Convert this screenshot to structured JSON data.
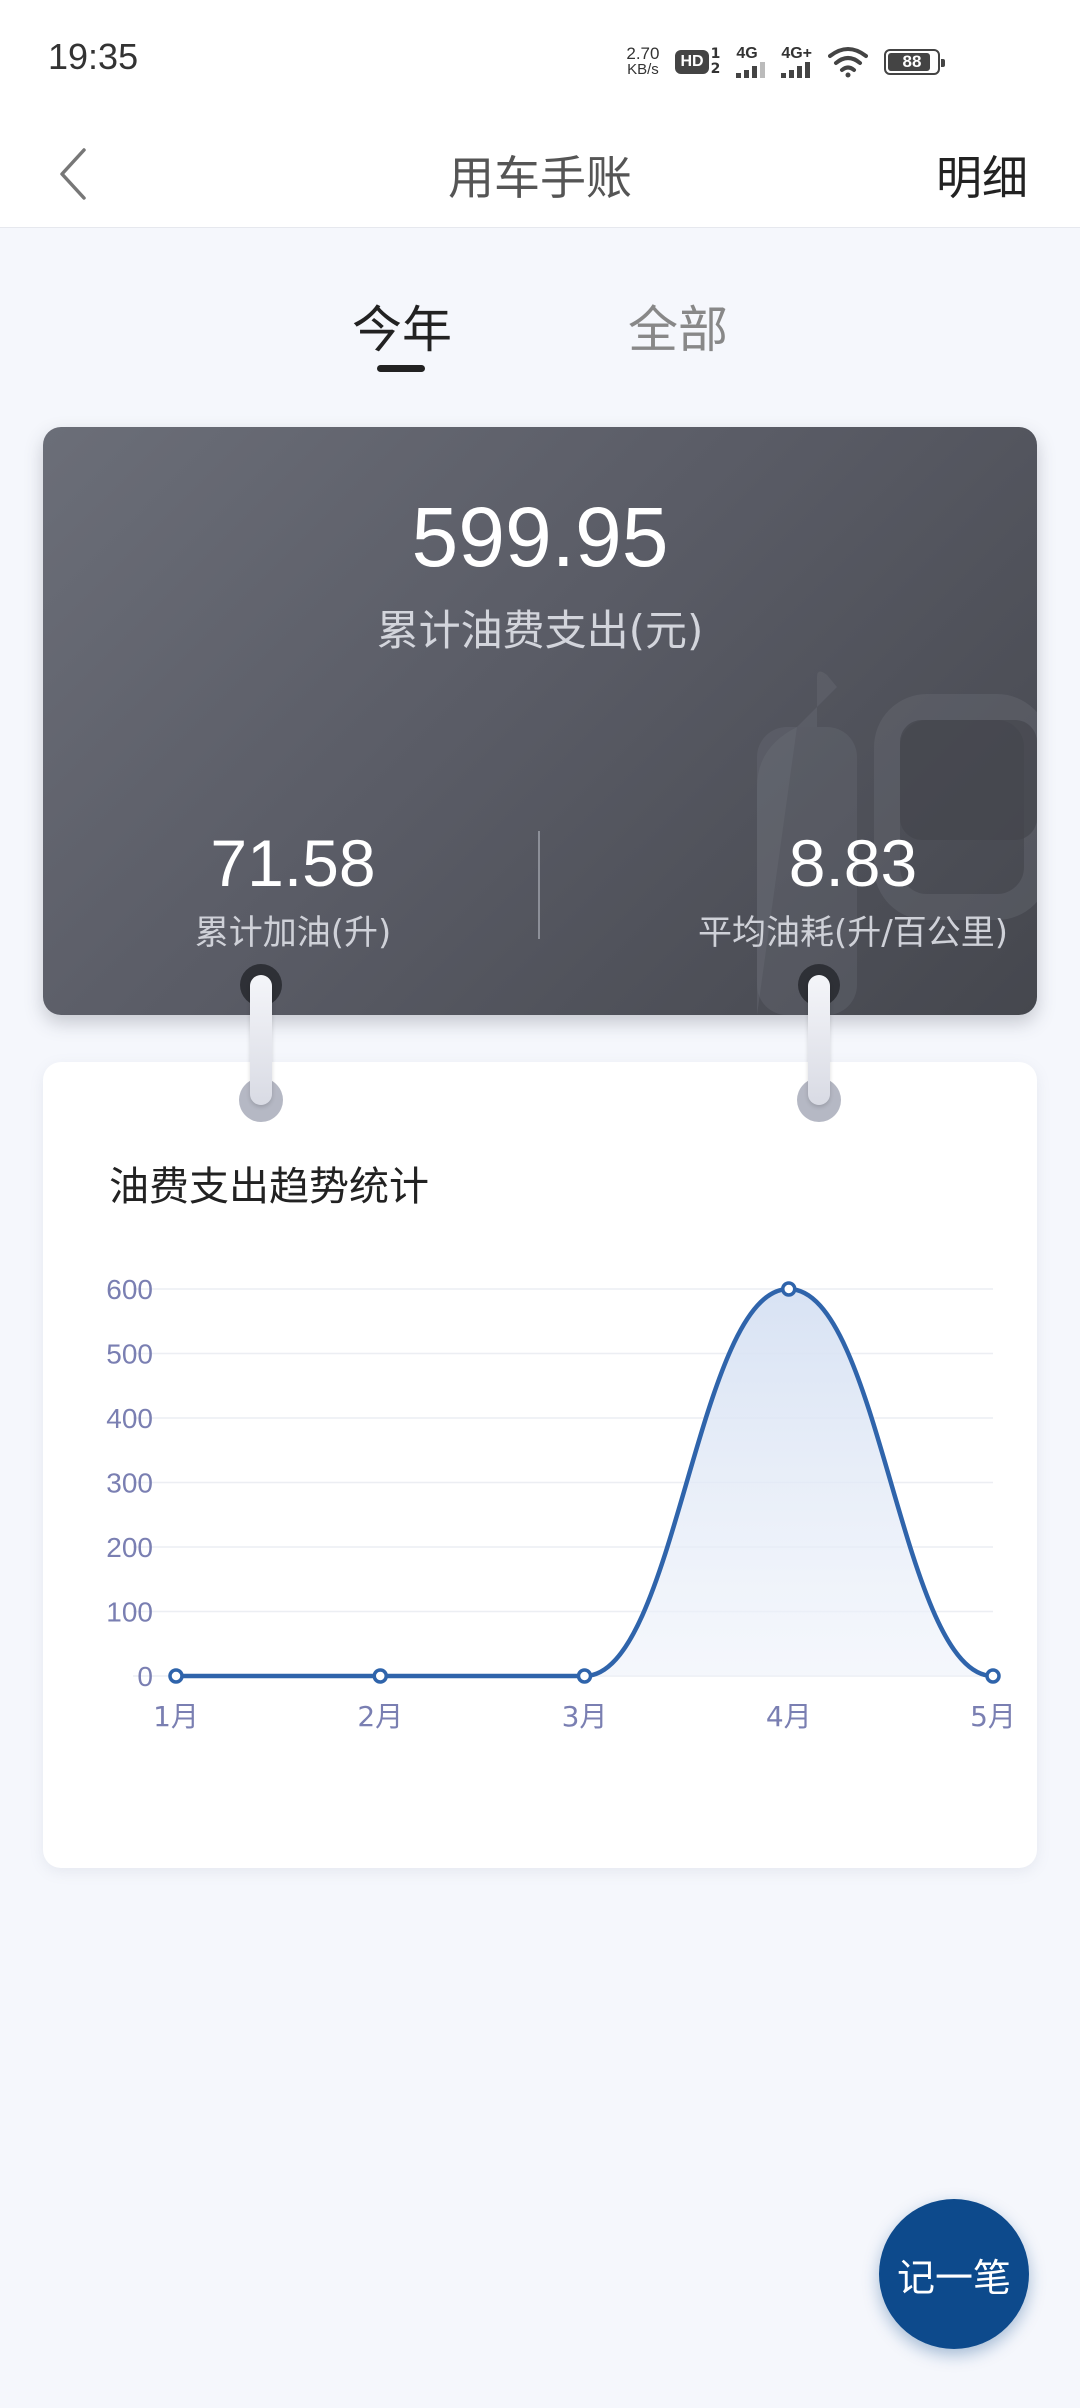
{
  "status_bar": {
    "time": "19:35",
    "net_speed_value": "2.70",
    "net_speed_unit": "KB/s",
    "hd_label": "HD",
    "hd_sub_top": "1",
    "hd_sub_bottom": "2",
    "signal1_label": "4G",
    "signal2_label": "4G+",
    "battery_level": "88"
  },
  "nav": {
    "title": "用车手账",
    "detail_label": "明细"
  },
  "tabs": [
    {
      "label": "今年",
      "active": true
    },
    {
      "label": "全部",
      "active": false
    }
  ],
  "summary": {
    "total_value": "599.95",
    "total_label": "累计油费支出(元)",
    "fuel_value": "71.58",
    "fuel_label": "累计加油(升)",
    "consumption_value": "8.83",
    "consumption_label": "平均油耗(升/百公里)"
  },
  "chart": {
    "title": "油费支出趋势统计"
  },
  "chart_data": {
    "type": "area",
    "categories": [
      "1月",
      "2月",
      "3月",
      "4月",
      "5月"
    ],
    "values": [
      0,
      0,
      0,
      599.95,
      0
    ],
    "ylim": [
      0,
      600
    ],
    "yticks": [
      0,
      100,
      200,
      300,
      400,
      500,
      600
    ],
    "grid": true,
    "line_color": "#2f64ab",
    "fill_color": "#dde6f5",
    "axis_label_color": "#7a7fb2"
  },
  "fab": {
    "label": "记一笔"
  },
  "colors": {
    "accent": "#0d4a8c",
    "card_dark": "#5a5c66"
  }
}
